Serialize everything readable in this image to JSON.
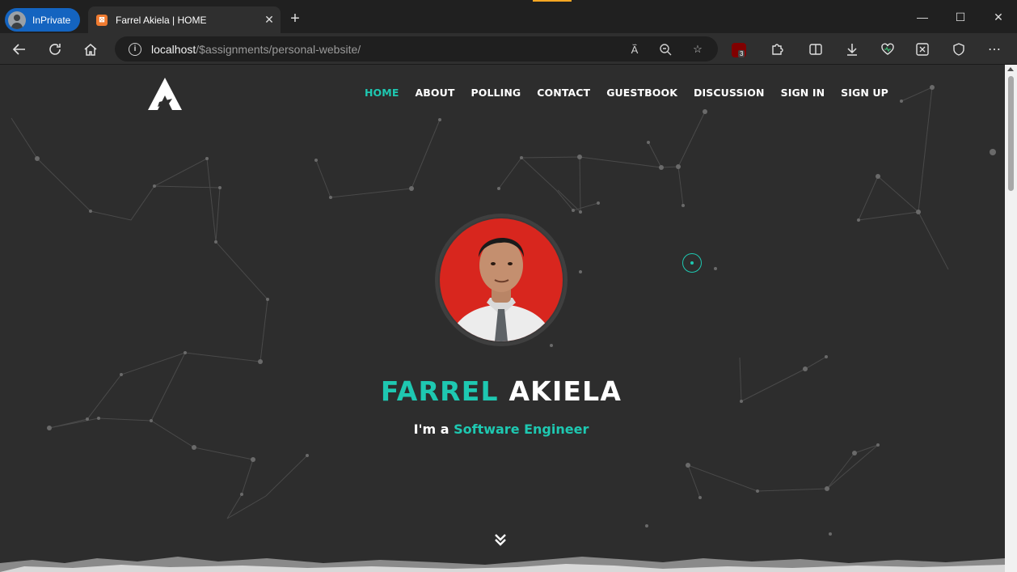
{
  "browser": {
    "profile_label": "InPrivate",
    "tab_title": "Farrel Akiela | HOME",
    "url_host": "localhost",
    "url_path": "/$assignments/personal-website/",
    "extension_badge_count": "3"
  },
  "nav": {
    "items": [
      "HOME",
      "ABOUT",
      "POLLING",
      "CONTACT",
      "GUESTBOOK",
      "DISCUSSION",
      "SIGN IN",
      "SIGN UP"
    ],
    "active": "HOME"
  },
  "hero": {
    "first_name": "FARREL",
    "last_name": "AKIELA",
    "tagline_prefix": "I'm a",
    "role": "Software Engineer"
  },
  "colors": {
    "accent": "#1ec8b1",
    "background": "#2d2d2d"
  }
}
